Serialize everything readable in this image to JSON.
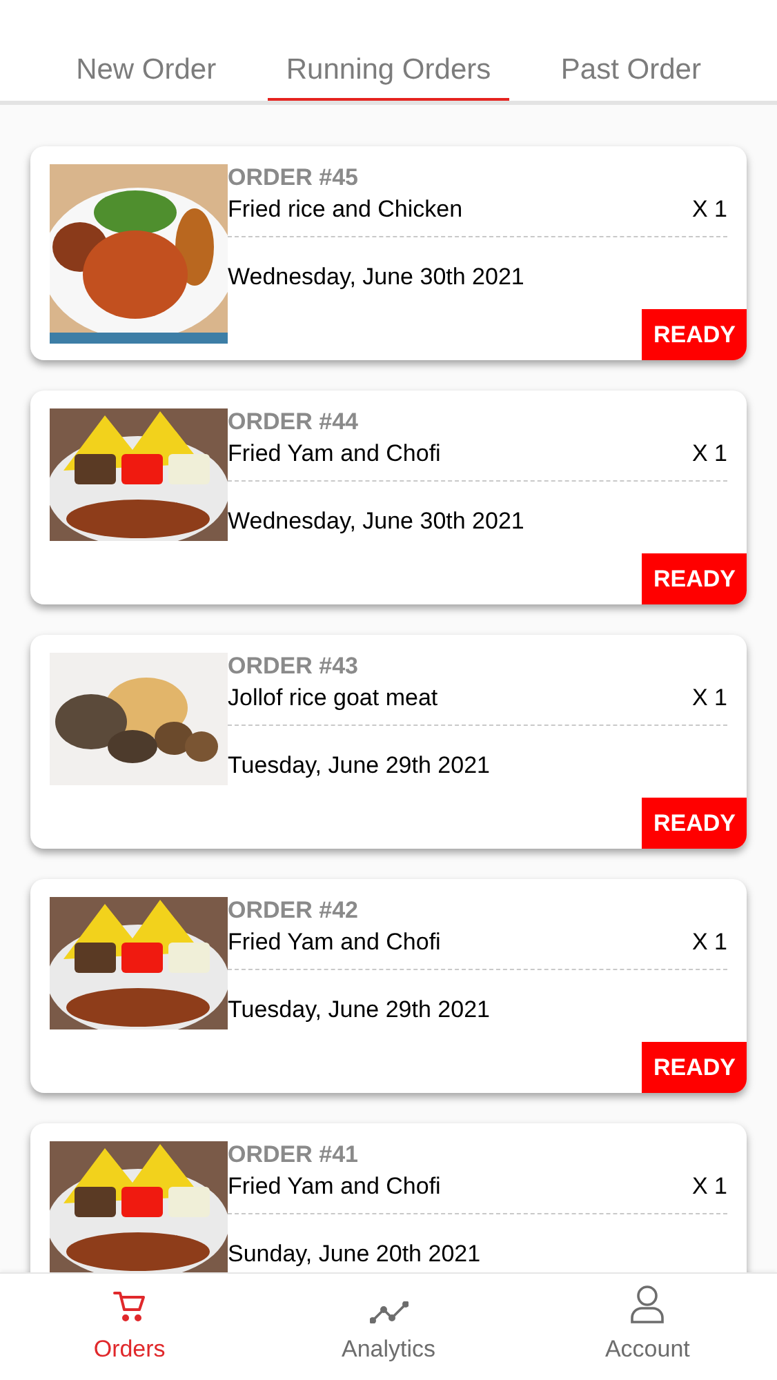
{
  "tabs": [
    {
      "label": "New Order",
      "selected": false
    },
    {
      "label": "Running Orders",
      "selected": true
    },
    {
      "label": "Past Order",
      "selected": false
    }
  ],
  "orders": [
    {
      "number": "ORDER #45",
      "item": "Fried rice and Chicken",
      "quantity": "X 1",
      "date": "Wednesday, June 30th 2021",
      "status": "READY"
    },
    {
      "number": "ORDER #44",
      "item": "Fried Yam and Chofi",
      "quantity": "X 1",
      "date": "Wednesday, June 30th 2021",
      "status": "READY"
    },
    {
      "number": "ORDER #43",
      "item": "Jollof rice goat meat",
      "quantity": "X 1",
      "date": "Tuesday, June 29th 2021",
      "status": "READY"
    },
    {
      "number": "ORDER #42",
      "item": "Fried Yam and Chofi",
      "quantity": "X 1",
      "date": "Tuesday, June 29th 2021",
      "status": "READY"
    },
    {
      "number": "ORDER #41",
      "item": "Fried Yam and Chofi",
      "quantity": "X 1",
      "date": "Sunday, June 20th 2021"
    }
  ],
  "bottom_nav": [
    {
      "label": "Orders",
      "kind": "cart",
      "selected": true
    },
    {
      "label": "Analytics",
      "kind": "chart",
      "selected": false
    },
    {
      "label": "Account",
      "kind": "user",
      "selected": false
    }
  ]
}
